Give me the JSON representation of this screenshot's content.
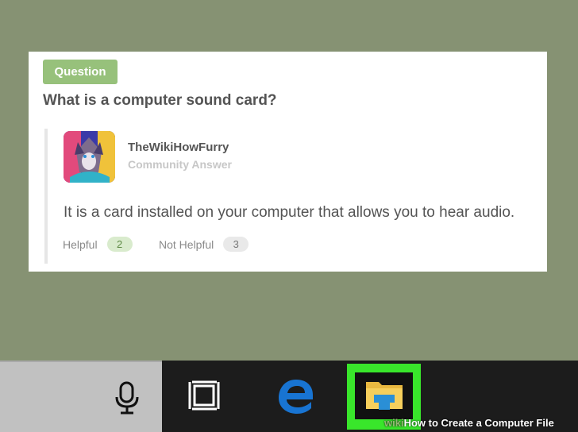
{
  "question": {
    "badge": "Question",
    "title": "What is a computer sound card?"
  },
  "answer": {
    "author": "TheWikiHowFurry",
    "role": "Community Answer",
    "text": "It is a card installed on your computer that allows you to hear audio.",
    "helpful_label": "Helpful",
    "helpful_count": "2",
    "not_helpful_label": "Not Helpful",
    "not_helpful_count": "3"
  },
  "taskbar": {
    "icons": [
      "microphone-icon",
      "task-view-icon",
      "edge-icon",
      "file-explorer-icon"
    ],
    "highlight_color": "#39e62b"
  },
  "watermark": {
    "wiki": "wiki",
    "text": "How to Create a Computer File"
  },
  "colors": {
    "background": "#869273",
    "badge": "#97c17b",
    "taskbar": "#1c1c1c"
  }
}
